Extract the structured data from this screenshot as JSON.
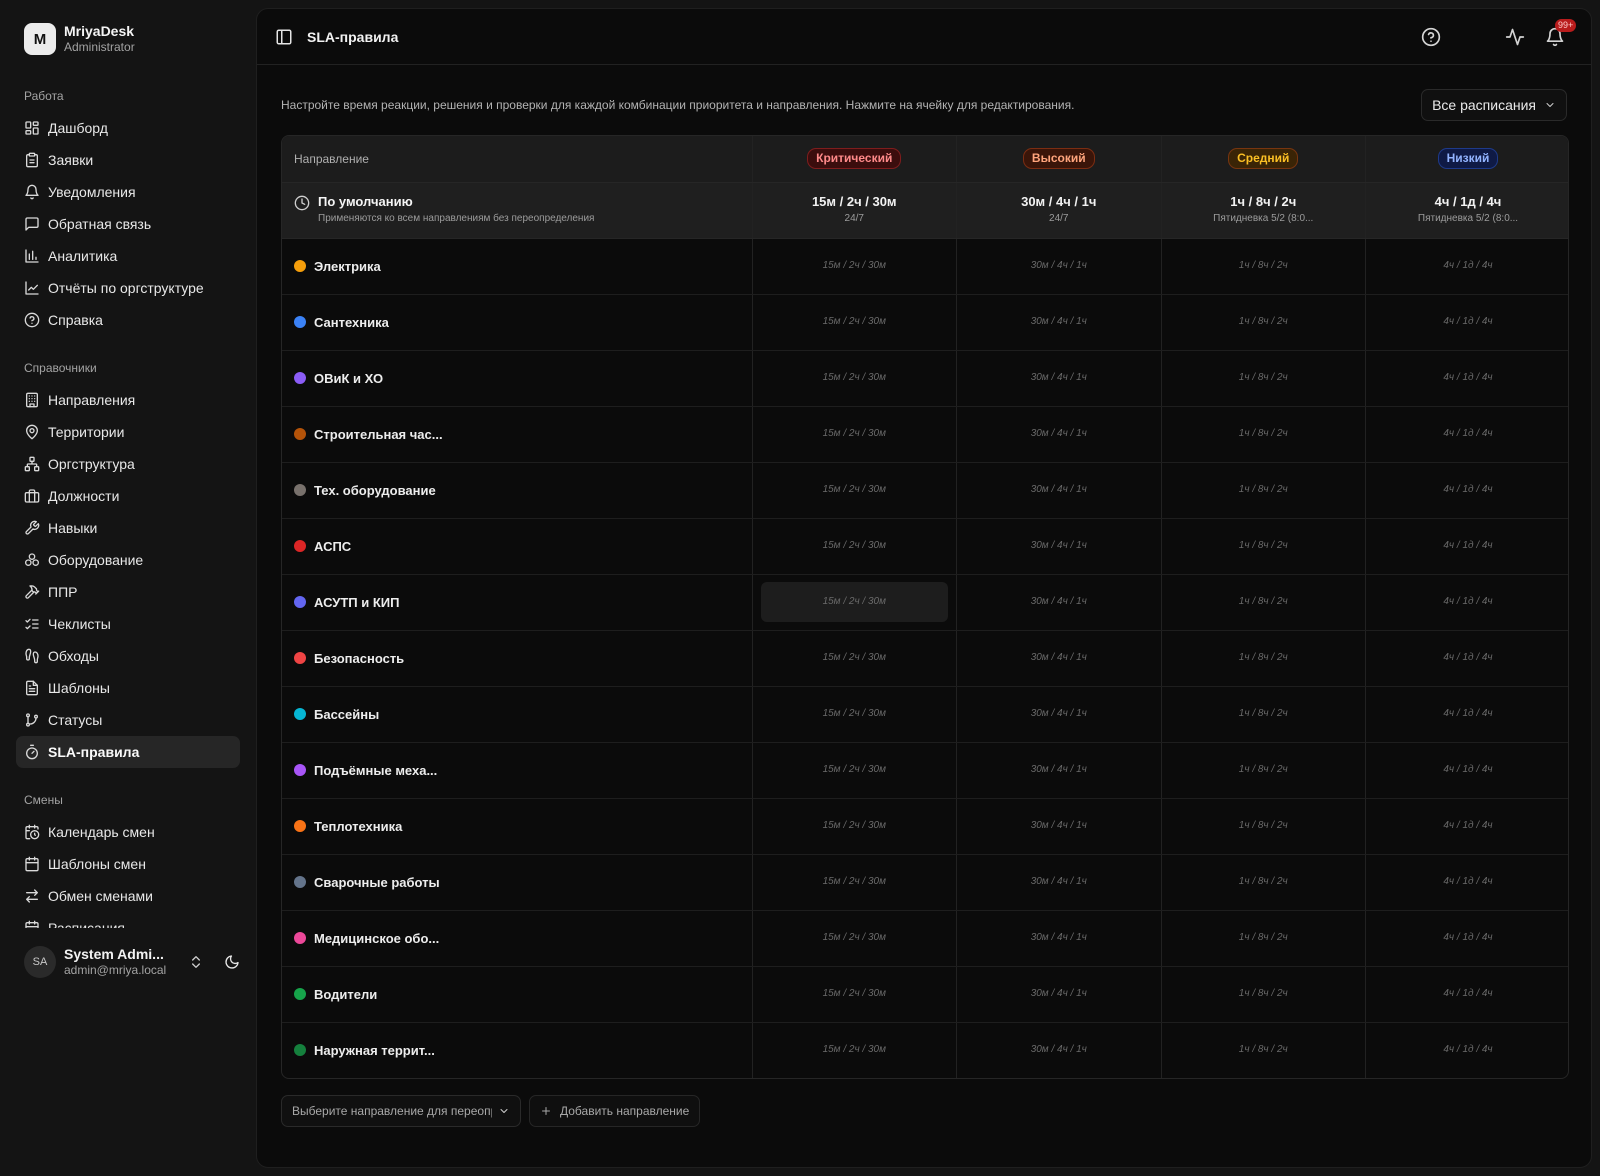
{
  "brand": {
    "logo_letter": "M",
    "name": "MriyaDesk",
    "role": "Administrator"
  },
  "sidebar": {
    "groups": [
      {
        "title": "Работа",
        "items": [
          {
            "label": "Дашборд",
            "icon": "dashboard-icon"
          },
          {
            "label": "Заявки",
            "icon": "clipboard-icon"
          },
          {
            "label": "Уведомления",
            "icon": "bell-icon"
          },
          {
            "label": "Обратная связь",
            "icon": "message-square-icon"
          },
          {
            "label": "Аналитика",
            "icon": "bar-chart-icon"
          },
          {
            "label": "Отчёты по оргструктуре",
            "icon": "line-chart-icon"
          },
          {
            "label": "Справка",
            "icon": "help-circle-icon"
          }
        ]
      },
      {
        "title": "Справочники",
        "items": [
          {
            "label": "Направления",
            "icon": "building-icon"
          },
          {
            "label": "Территории",
            "icon": "map-pin-icon"
          },
          {
            "label": "Оргструктура",
            "icon": "network-icon"
          },
          {
            "label": "Должности",
            "icon": "briefcase-icon"
          },
          {
            "label": "Навыки",
            "icon": "wrench-icon"
          },
          {
            "label": "Оборудование",
            "icon": "boxes-icon"
          },
          {
            "label": "ППР",
            "icon": "hammer-icon"
          },
          {
            "label": "Чеклисты",
            "icon": "list-checks-icon"
          },
          {
            "label": "Обходы",
            "icon": "footprints-icon"
          },
          {
            "label": "Шаблоны",
            "icon": "file-text-icon"
          },
          {
            "label": "Статусы",
            "icon": "git-branch-icon"
          },
          {
            "label": "SLA-правила",
            "icon": "timer-icon",
            "active": true
          }
        ]
      },
      {
        "title": "Смены",
        "items": [
          {
            "label": "Календарь смен",
            "icon": "calendar-clock-icon"
          },
          {
            "label": "Шаблоны смен",
            "icon": "calendar-icon"
          },
          {
            "label": "Обмен сменами",
            "icon": "swap-icon"
          },
          {
            "label": "Расписания",
            "icon": "calendar-days-icon"
          }
        ]
      }
    ]
  },
  "user": {
    "initials": "SA",
    "name": "System Admi...",
    "email": "admin@mriya.local"
  },
  "topbar": {
    "title": "SLA-правила",
    "notification_count": "99+"
  },
  "page": {
    "description": "Настройте время реакции, решения и проверки для каждой комбинации приоритета и направления. Нажмите на ячейку для редактирования.",
    "schedule_filter": "Все расписания"
  },
  "table": {
    "direction_header": "Направление",
    "priorities": [
      {
        "label": "Критический",
        "class": "p-crit",
        "default": "15м / 2ч / 30м",
        "schedule": "24/7",
        "cell": "15м / 2ч / 30м"
      },
      {
        "label": "Высокий",
        "class": "p-high",
        "default": "30м / 4ч / 1ч",
        "schedule": "24/7",
        "cell": "30м / 4ч / 1ч"
      },
      {
        "label": "Средний",
        "class": "p-mid",
        "default": "1ч / 8ч / 2ч",
        "schedule": "Пятидневка 5/2 (8:0...",
        "cell": "1ч / 8ч / 2ч"
      },
      {
        "label": "Низкий",
        "class": "p-low",
        "default": "4ч / 1д / 4ч",
        "schedule": "Пятидневка 5/2 (8:0...",
        "cell": "4ч / 1д / 4ч"
      }
    ],
    "default_row": {
      "title": "По умолчанию",
      "subtitle": "Применяются ко всем направлениям без переопределения"
    },
    "directions": [
      {
        "name": "Электрика",
        "color": "#f59e0b"
      },
      {
        "name": "Сантехника",
        "color": "#3b82f6"
      },
      {
        "name": "ОВиК и ХО",
        "color": "#8b5cf6"
      },
      {
        "name": "Строительная час...",
        "color": "#b45309"
      },
      {
        "name": "Тех. оборудование",
        "color": "#78716c"
      },
      {
        "name": "АСПС",
        "color": "#dc2626"
      },
      {
        "name": "АСУТП и КИП",
        "color": "#6366f1"
      },
      {
        "name": "Безопасность",
        "color": "#ef4444"
      },
      {
        "name": "Бассейны",
        "color": "#06b6d4"
      },
      {
        "name": "Подъёмные меха...",
        "color": "#a855f7"
      },
      {
        "name": "Теплотехника",
        "color": "#f97316"
      },
      {
        "name": "Сварочные работы",
        "color": "#64748b"
      },
      {
        "name": "Медицинское обо...",
        "color": "#ec4899"
      },
      {
        "name": "Водители",
        "color": "#16a34a"
      },
      {
        "name": "Наружная террит...",
        "color": "#15803d"
      }
    ]
  },
  "actions": {
    "direction_select_placeholder": "Выберите направление для переопределения",
    "add_direction": "Добавить направление"
  }
}
